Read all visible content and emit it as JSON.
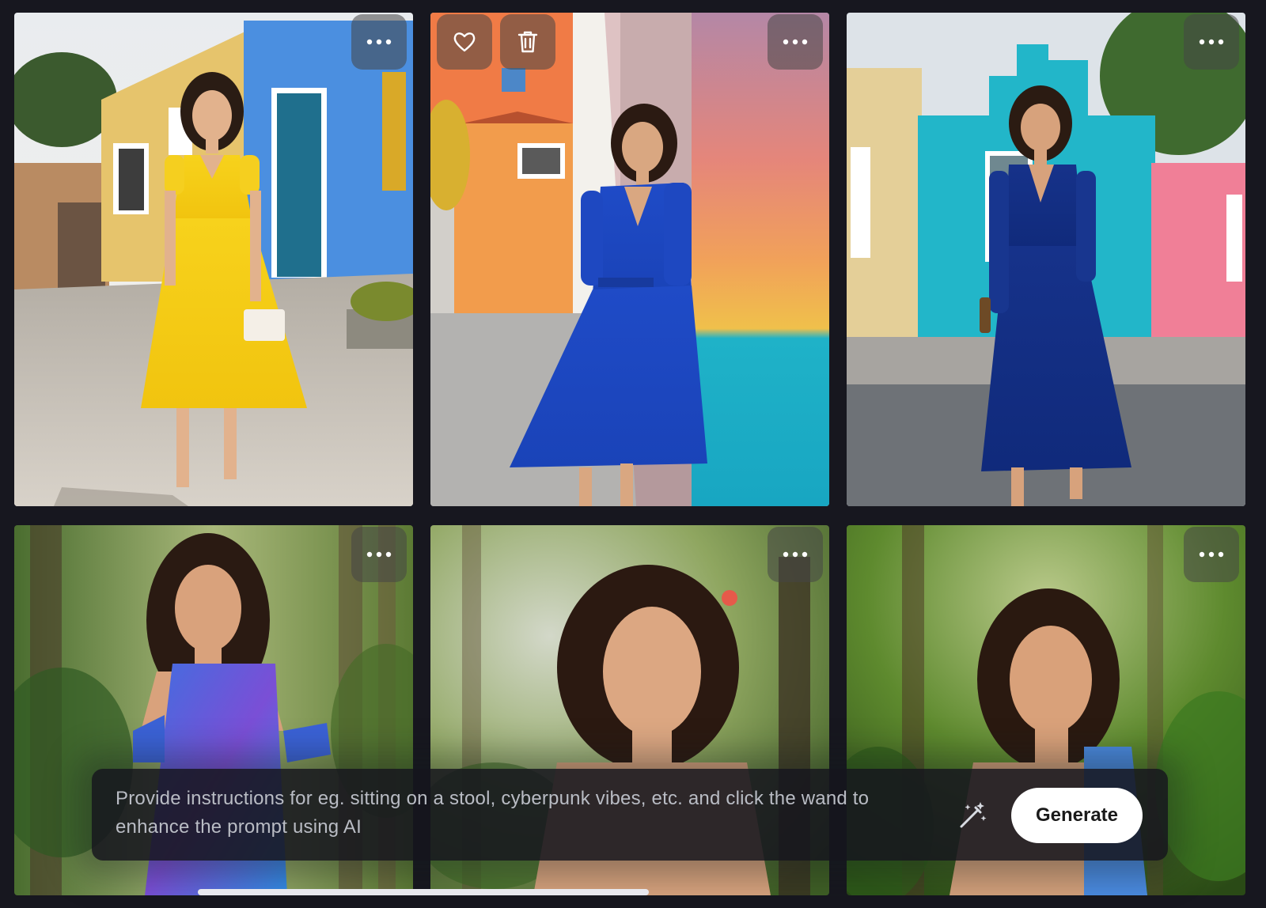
{
  "gallery": {
    "tiles": [
      {
        "scene": "street-yellow-dress",
        "actions": [
          "more-icon"
        ]
      },
      {
        "scene": "street-blue-dress-wall",
        "actions": [
          "heart-icon",
          "trash-icon",
          "more-icon"
        ]
      },
      {
        "scene": "street-navy-dress-turquoise-house",
        "actions": [
          "more-icon"
        ]
      },
      {
        "scene": "forest-portrait-floral-dress",
        "actions": [
          "more-icon"
        ]
      },
      {
        "scene": "forest-portrait-close-up",
        "actions": [
          "more-icon"
        ]
      },
      {
        "scene": "forest-portrait-wavy-hair",
        "actions": [
          "more-icon"
        ]
      }
    ]
  },
  "prompt_bar": {
    "text": "Provide instructions for eg. sitting on a stool, cyberpunk vibes, etc. and click the wand to enhance the prompt using AI",
    "wand_icon": "magic-wand-icon",
    "generate_label": "Generate"
  },
  "colors": {
    "background": "#17171f",
    "prompt_bar": "#16161e",
    "prompt_text": "#b9bcc4",
    "button_bg": "#ffffff",
    "button_text": "#1a1a1a"
  }
}
